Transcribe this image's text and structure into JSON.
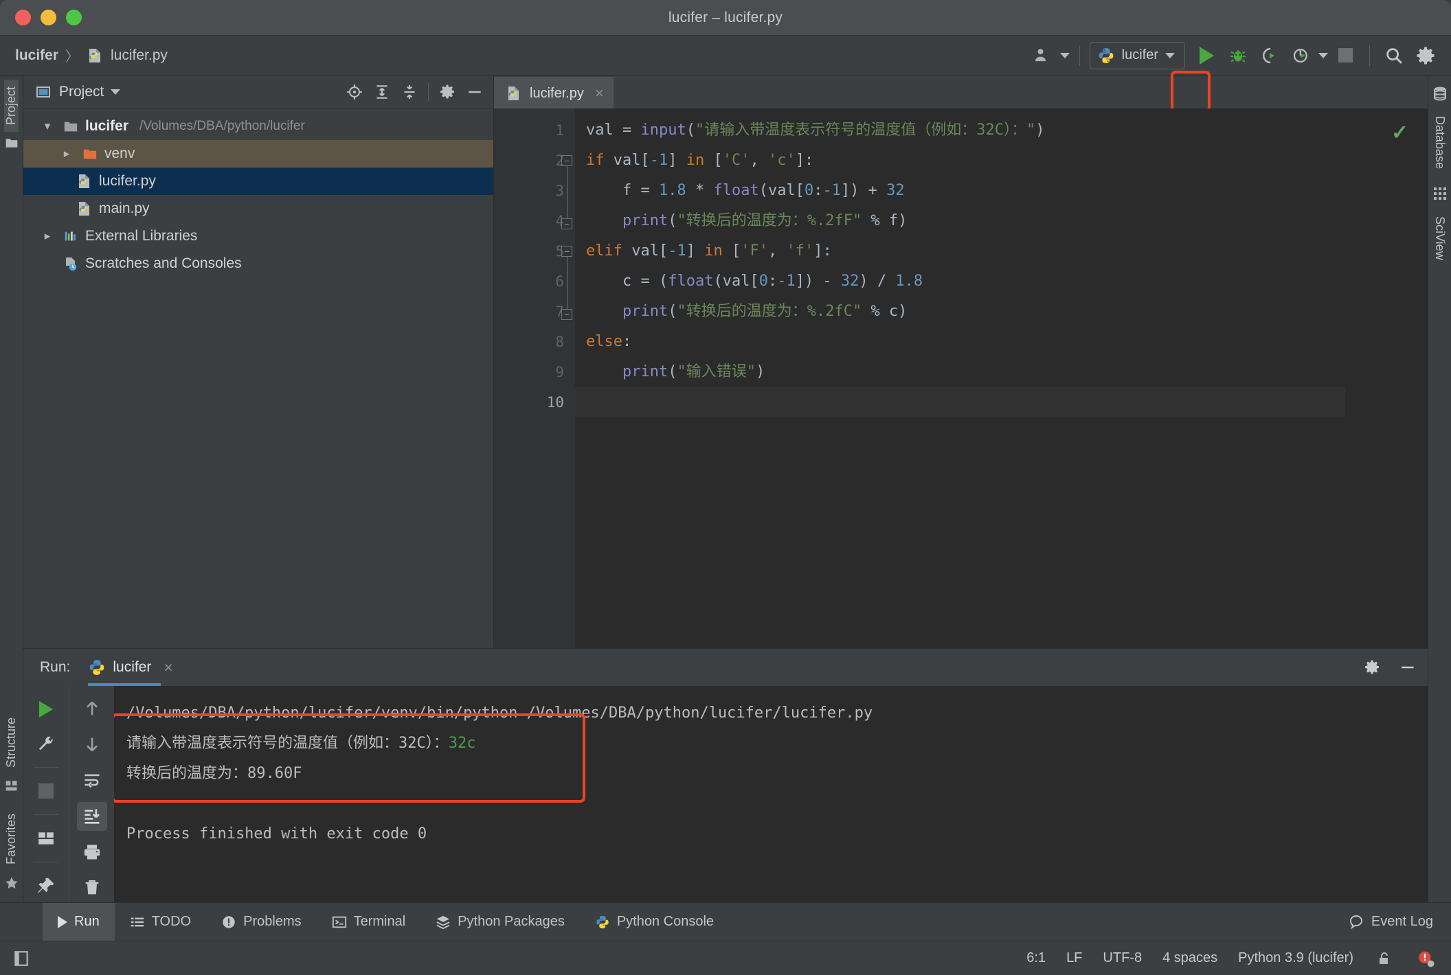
{
  "window": {
    "title": "lucifer – lucifer.py",
    "controls": [
      "close",
      "minimize",
      "zoom"
    ]
  },
  "breadcrumb": {
    "project": "lucifer",
    "separator": "〉",
    "file": "lucifer.py"
  },
  "toolbar": {
    "run_config_label": "lucifer",
    "icons": [
      "user-icon",
      "python-icon",
      "run-icon",
      "debug-icon",
      "run-coverage-icon",
      "profile-icon",
      "stop-icon",
      "search-icon",
      "settings-icon"
    ]
  },
  "left_stripe": {
    "tabs": [
      {
        "label": "Project",
        "icon": "folder-icon",
        "active": true
      },
      {
        "label": "Structure",
        "icon": "structure-icon",
        "active": false
      },
      {
        "label": "Favorites",
        "icon": "star-icon",
        "active": false
      }
    ]
  },
  "right_stripe": {
    "tabs": [
      {
        "label": "Database",
        "icon": "database-icon"
      },
      {
        "label": "SciView",
        "icon": "grid-icon"
      }
    ]
  },
  "project_panel": {
    "title": "Project",
    "header_icons": [
      "locate-icon",
      "expand-all-icon",
      "collapse-all-icon",
      "gear-icon",
      "minimize-icon"
    ],
    "tree": [
      {
        "label": "lucifer",
        "path": "/Volumes/DBA/python/lucifer",
        "icon": "folder-icon",
        "twisty": "down",
        "indent": 0,
        "bold": true,
        "state": "normal"
      },
      {
        "label": "venv",
        "path": "",
        "icon": "folder-orange-icon",
        "twisty": "right",
        "indent": 1,
        "bold": false,
        "state": "highlight"
      },
      {
        "label": "lucifer.py",
        "path": "",
        "icon": "python-file-icon",
        "twisty": "",
        "indent": 2,
        "bold": false,
        "state": "selected"
      },
      {
        "label": "main.py",
        "path": "",
        "icon": "python-file-icon",
        "twisty": "",
        "indent": 2,
        "bold": false,
        "state": "normal"
      },
      {
        "label": "External Libraries",
        "path": "",
        "icon": "library-icon",
        "twisty": "right",
        "indent": 0,
        "bold": false,
        "state": "normal"
      },
      {
        "label": "Scratches and Consoles",
        "path": "",
        "icon": "scratches-icon",
        "twisty": "",
        "indent": 0,
        "bold": false,
        "state": "normal"
      }
    ]
  },
  "editor": {
    "tab": {
      "label": "lucifer.py",
      "icon": "python-file-icon",
      "close": "×"
    },
    "line_numbers": [
      "1",
      "2",
      "3",
      "4",
      "5",
      "6",
      "7",
      "8",
      "9",
      "10"
    ],
    "current_line": "10",
    "inspection_status": "ok-check",
    "lines": [
      {
        "n": "1",
        "tokens": [
          {
            "t": "val ",
            "c": "t"
          },
          {
            "t": "=",
            "c": "t"
          },
          {
            "t": " ",
            "c": "t"
          },
          {
            "t": "input",
            "c": "fn"
          },
          {
            "t": "(",
            "c": "t"
          },
          {
            "t": "\"请输入带温度表示符号的温度值（例如：32C）：\"",
            "c": "s"
          },
          {
            "t": ")",
            "c": "t"
          }
        ]
      },
      {
        "n": "2",
        "tokens": [
          {
            "t": "if",
            "c": "k"
          },
          {
            "t": " val[",
            "c": "t"
          },
          {
            "t": "-1",
            "c": "n"
          },
          {
            "t": "] ",
            "c": "t"
          },
          {
            "t": "in",
            "c": "k"
          },
          {
            "t": " [",
            "c": "t"
          },
          {
            "t": "'C'",
            "c": "s"
          },
          {
            "t": ", ",
            "c": "t"
          },
          {
            "t": "'c'",
            "c": "s"
          },
          {
            "t": "]:",
            "c": "t"
          }
        ]
      },
      {
        "n": "3",
        "tokens": [
          {
            "t": "    f = ",
            "c": "t"
          },
          {
            "t": "1.8",
            "c": "n"
          },
          {
            "t": " * ",
            "c": "t"
          },
          {
            "t": "float",
            "c": "fn"
          },
          {
            "t": "(val[",
            "c": "t"
          },
          {
            "t": "0",
            "c": "n"
          },
          {
            "t": ":",
            "c": "t"
          },
          {
            "t": "-1",
            "c": "n"
          },
          {
            "t": "]) + ",
            "c": "t"
          },
          {
            "t": "32",
            "c": "n"
          }
        ]
      },
      {
        "n": "4",
        "tokens": [
          {
            "t": "    ",
            "c": "t"
          },
          {
            "t": "print",
            "c": "fn"
          },
          {
            "t": "(",
            "c": "t"
          },
          {
            "t": "\"转换后的温度为：%.2fF\"",
            "c": "s"
          },
          {
            "t": " % f)",
            "c": "t"
          }
        ]
      },
      {
        "n": "5",
        "tokens": [
          {
            "t": "elif",
            "c": "k"
          },
          {
            "t": " val[",
            "c": "t"
          },
          {
            "t": "-1",
            "c": "n"
          },
          {
            "t": "] ",
            "c": "t"
          },
          {
            "t": "in",
            "c": "k"
          },
          {
            "t": " [",
            "c": "t"
          },
          {
            "t": "'F'",
            "c": "s"
          },
          {
            "t": ", ",
            "c": "t"
          },
          {
            "t": "'f'",
            "c": "s"
          },
          {
            "t": "]:",
            "c": "t"
          }
        ]
      },
      {
        "n": "6",
        "tokens": [
          {
            "t": "    c = (",
            "c": "t"
          },
          {
            "t": "float",
            "c": "fn"
          },
          {
            "t": "(val[",
            "c": "t"
          },
          {
            "t": "0",
            "c": "n"
          },
          {
            "t": ":",
            "c": "t"
          },
          {
            "t": "-1",
            "c": "n"
          },
          {
            "t": "]) - ",
            "c": "t"
          },
          {
            "t": "32",
            "c": "n"
          },
          {
            "t": ") / ",
            "c": "t"
          },
          {
            "t": "1.8",
            "c": "n"
          }
        ]
      },
      {
        "n": "7",
        "tokens": [
          {
            "t": "    ",
            "c": "t"
          },
          {
            "t": "print",
            "c": "fn"
          },
          {
            "t": "(",
            "c": "t"
          },
          {
            "t": "\"转换后的温度为：%.2fC\"",
            "c": "s"
          },
          {
            "t": " % c)",
            "c": "t"
          }
        ]
      },
      {
        "n": "8",
        "tokens": [
          {
            "t": "else",
            "c": "k"
          },
          {
            "t": ":",
            "c": "t"
          }
        ]
      },
      {
        "n": "9",
        "tokens": [
          {
            "t": "    ",
            "c": "t"
          },
          {
            "t": "print",
            "c": "fn"
          },
          {
            "t": "(",
            "c": "t"
          },
          {
            "t": "\"输入错误\"",
            "c": "s"
          },
          {
            "t": ")",
            "c": "t"
          }
        ]
      },
      {
        "n": "10",
        "tokens": []
      }
    ]
  },
  "run_panel": {
    "label": "Run:",
    "tab_label": "lucifer",
    "tab_close": "×",
    "header_icons": [
      "gear-icon",
      "minimize-icon"
    ],
    "left_tools": [
      "rerun-icon",
      "wrench-icon",
      "stop-icon",
      "layout-icon",
      "pin-icon"
    ],
    "right_tools": [
      "up-arrow-icon",
      "down-arrow-icon",
      "soft-wrap-icon",
      "scroll-to-end-icon",
      "print-icon",
      "trash-icon"
    ],
    "console_lines": [
      {
        "text": "/Volumes/DBA/python/lucifer/venv/bin/python /Volumes/DBA/python/lucifer/lucifer.py",
        "highlighted": false,
        "input_value": ""
      },
      {
        "text": "请输入带温度表示符号的温度值（例如：32C）：",
        "highlighted": true,
        "input_value": "32c"
      },
      {
        "text": "转换后的温度为：89.60F",
        "highlighted": true,
        "input_value": ""
      },
      {
        "text": "",
        "highlighted": false,
        "input_value": ""
      },
      {
        "text": "Process finished with exit code 0",
        "highlighted": false,
        "input_value": ""
      }
    ]
  },
  "bottom_tabs": [
    {
      "label": "Run",
      "icon": "run-icon",
      "active": true
    },
    {
      "label": "TODO",
      "icon": "todo-icon",
      "active": false
    },
    {
      "label": "Problems",
      "icon": "problems-icon",
      "active": false
    },
    {
      "label": "Terminal",
      "icon": "terminal-icon",
      "active": false
    },
    {
      "label": "Python Packages",
      "icon": "packages-icon",
      "active": false
    },
    {
      "label": "Python Console",
      "icon": "python-icon",
      "active": false
    }
  ],
  "event_log": {
    "label": "Event Log",
    "icon": "balloon-icon"
  },
  "statusbar": {
    "caret": "6:1",
    "line_sep": "LF",
    "encoding": "UTF-8",
    "indent": "4 spaces",
    "interpreter": "Python 3.9 (lucifer)",
    "icons": [
      "unlock-icon",
      "inspection-error-icon"
    ]
  },
  "colors": {
    "accent_highlight": "#ef4323",
    "run_green": "#4aa843",
    "selection_blue": "#0d2f4f",
    "tab_underline": "#4a88c7",
    "editor_bg": "#2b2b2b",
    "chrome_bg": "#3c3f41"
  }
}
